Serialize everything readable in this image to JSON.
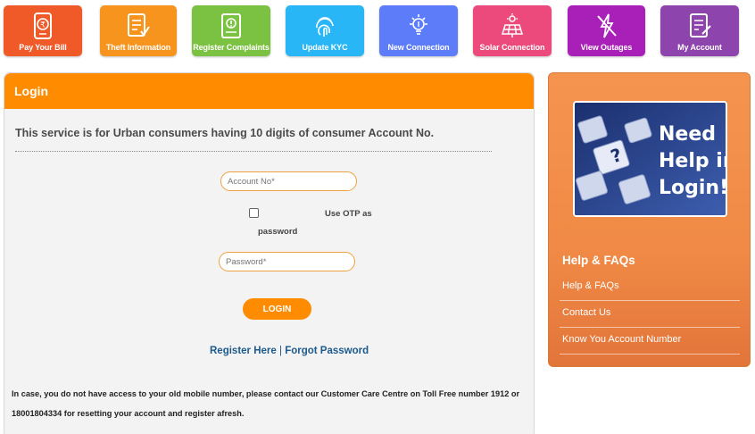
{
  "tiles": [
    {
      "label": "Pay Your Bill",
      "color": "#f05a28",
      "icon": "rupee-bill-icon"
    },
    {
      "label": "Theft Information",
      "color": "#f7941d",
      "icon": "document-check-icon"
    },
    {
      "label": "Register Complaints",
      "color": "#7cc242",
      "icon": "complaint-document-icon"
    },
    {
      "label": "Update KYC",
      "color": "#29b6f6",
      "icon": "fingerprint-icon"
    },
    {
      "label": "New Connection",
      "color": "#5c7cfa",
      "icon": "lightbulb-icon"
    },
    {
      "label": "Solar Connection",
      "color": "#ec4a7c",
      "icon": "solar-panel-icon"
    },
    {
      "label": "View Outages",
      "color": "#a820b8",
      "icon": "power-off-icon"
    },
    {
      "label": "My Account",
      "color": "#8e44ad",
      "icon": "account-document-icon"
    }
  ],
  "login": {
    "title": "Login",
    "service_text": "This service is for Urban consumers having 10 digits of consumer Account No.",
    "account_placeholder": "Account No*",
    "otp_label_line1": "Use OTP as",
    "otp_label_line2": "password",
    "password_placeholder": "Password*",
    "login_button": "LOGIN",
    "register_link": "Register Here",
    "separator": "|",
    "forgot_link": "Forgot Password",
    "info_text": "In case, you do not have access to your old mobile number, please contact our Customer Care Centre on Toll Free number 1912 or 18001804334 for resetting your account and register afresh."
  },
  "help": {
    "image_text": [
      "Need",
      "Help in",
      "Login!"
    ],
    "title": "Help & FAQs",
    "items": [
      "Help & FAQs",
      "Contact Us",
      "Know You Account Number"
    ]
  },
  "colors": {
    "accent": "#ff8c00",
    "link": "#1d5a8c",
    "help_panel": "#f08a46"
  }
}
